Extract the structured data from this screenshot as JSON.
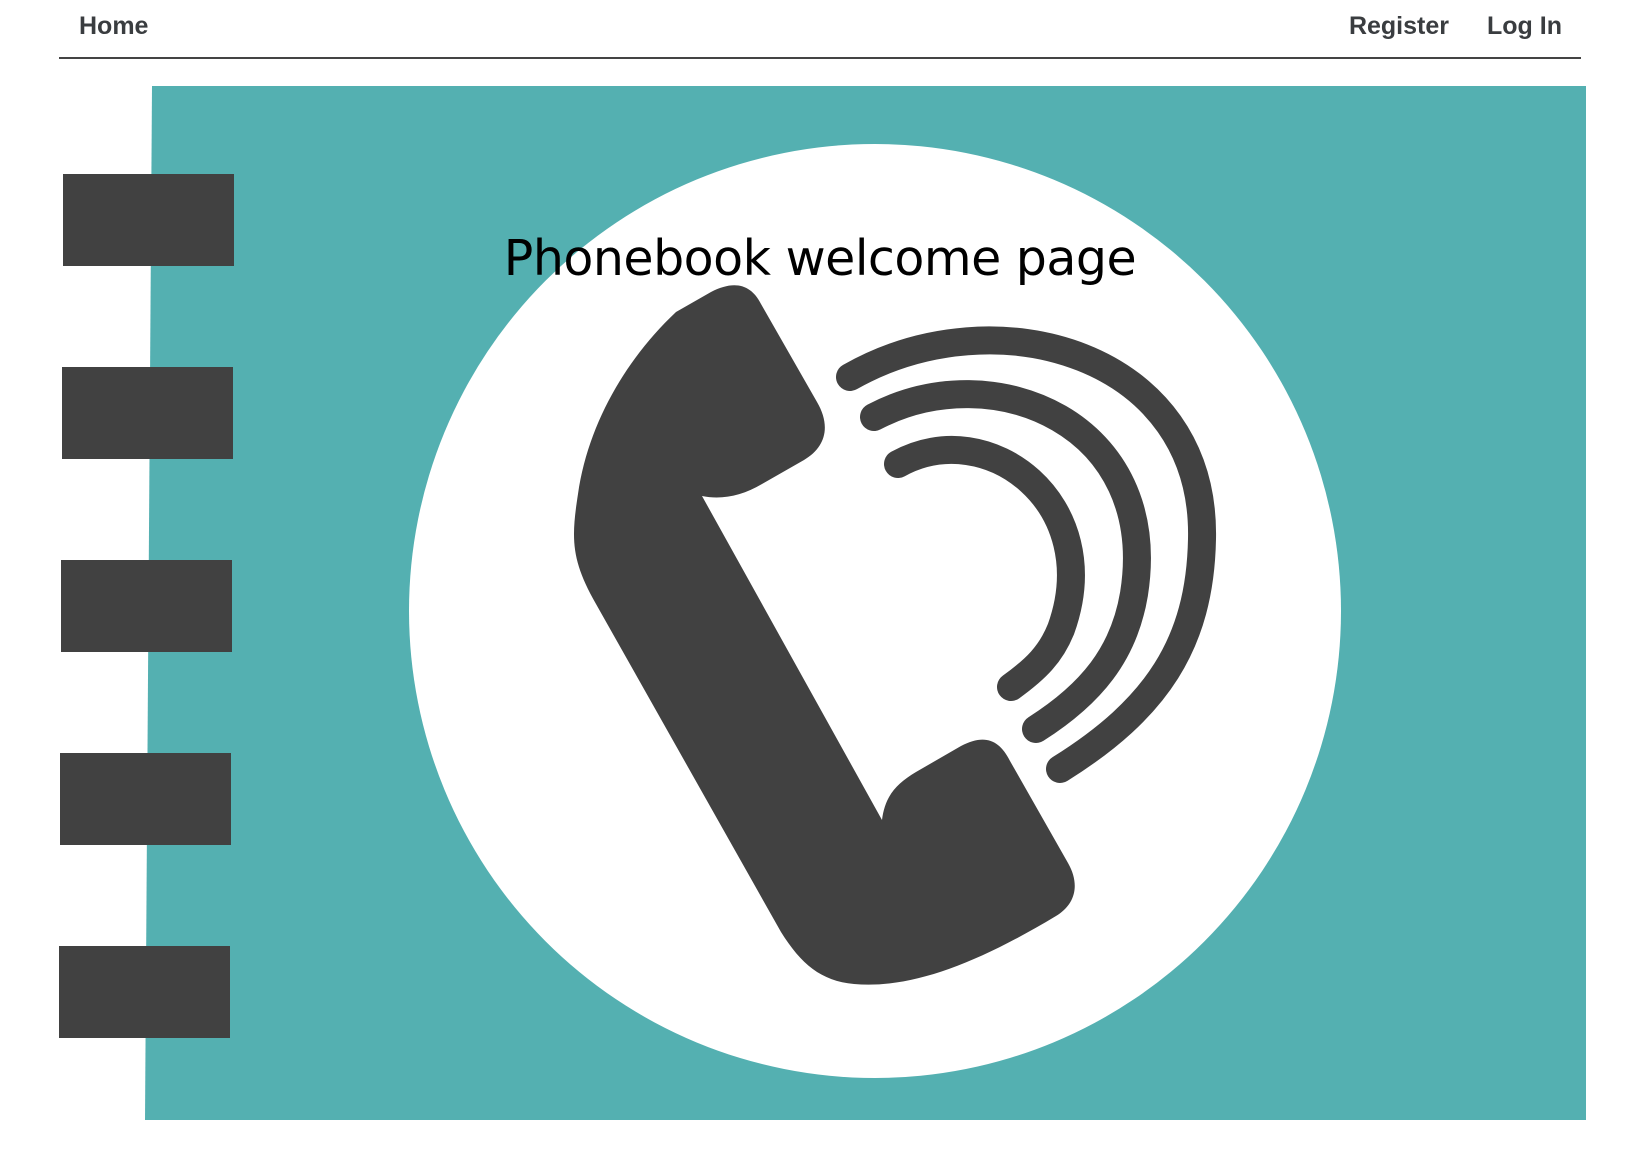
{
  "nav": {
    "home_label": "Home",
    "register_label": "Register",
    "login_label": "Log In"
  },
  "hero": {
    "title": "Phonebook welcome page",
    "image_icon": "phonebook-handset-icon"
  },
  "colors": {
    "teal": "#54b0b1",
    "dark": "#414141",
    "white": "#ffffff",
    "nav_text": "#3a3d40"
  }
}
